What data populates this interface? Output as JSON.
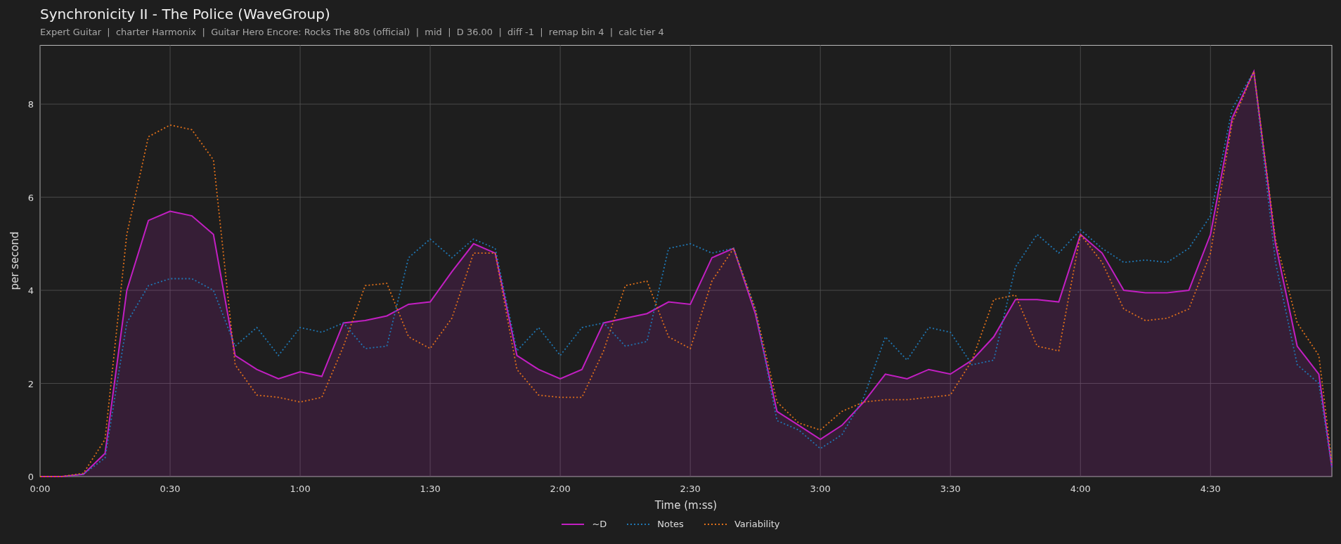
{
  "title": "Synchronicity II - The Police (WaveGroup)",
  "subtitle": "Expert Guitar  |  charter Harmonix  |  Guitar Hero Encore: Rocks The 80s (official)  |  mid  |  D 36.00  |  diff -1  |  remap bin 4  |  calc tier 4",
  "chart_data": {
    "type": "line",
    "xlabel": "Time (m:ss)",
    "ylabel": "per second",
    "x": [
      0,
      5,
      10,
      15,
      20,
      25,
      30,
      35,
      40,
      45,
      50,
      55,
      60,
      65,
      70,
      75,
      80,
      85,
      90,
      95,
      100,
      105,
      110,
      115,
      120,
      125,
      130,
      135,
      140,
      145,
      150,
      155,
      160,
      165,
      170,
      175,
      180,
      185,
      190,
      195,
      200,
      205,
      210,
      215,
      220,
      225,
      230,
      235,
      240,
      245,
      250,
      255,
      260,
      265,
      270,
      275,
      280,
      285,
      290,
      295,
      298
    ],
    "grid": true,
    "xlim": [
      0,
      298
    ],
    "ylim": [
      0,
      9.27
    ],
    "xticks": [
      {
        "value": 0,
        "label": "0:00"
      },
      {
        "value": 30,
        "label": "0:30"
      },
      {
        "value": 60,
        "label": "1:00"
      },
      {
        "value": 90,
        "label": "1:30"
      },
      {
        "value": 120,
        "label": "2:00"
      },
      {
        "value": 150,
        "label": "2:30"
      },
      {
        "value": 180,
        "label": "3:00"
      },
      {
        "value": 210,
        "label": "3:30"
      },
      {
        "value": 240,
        "label": "4:00"
      },
      {
        "value": 270,
        "label": "4:30"
      }
    ],
    "yticks": [
      0,
      2,
      4,
      6,
      8
    ],
    "series": [
      {
        "name": "~D",
        "color": "#c21fc2",
        "line_style": "solid",
        "values": [
          0,
          0,
          0.05,
          0.5,
          4.0,
          5.5,
          5.7,
          5.6,
          5.2,
          2.6,
          2.3,
          2.1,
          2.25,
          2.15,
          3.3,
          3.35,
          3.45,
          3.7,
          3.75,
          4.4,
          5.0,
          4.8,
          2.6,
          2.3,
          2.1,
          2.3,
          3.3,
          3.4,
          3.5,
          3.75,
          3.7,
          4.7,
          4.9,
          3.5,
          1.4,
          1.1,
          0.8,
          1.1,
          1.6,
          2.2,
          2.1,
          2.3,
          2.2,
          2.5,
          3.0,
          3.8,
          3.8,
          3.75,
          5.2,
          4.8,
          4.0,
          3.95,
          3.95,
          4.0,
          5.2,
          7.7,
          8.7,
          5.0,
          2.8,
          2.2,
          0.2
        ]
      },
      {
        "name": "Notes",
        "color": "#1f77b4",
        "line_style": "dotted",
        "values": [
          0,
          0,
          0.05,
          0.4,
          3.3,
          4.1,
          4.25,
          4.25,
          4.0,
          2.8,
          3.2,
          2.6,
          3.2,
          3.1,
          3.3,
          2.75,
          2.8,
          4.7,
          5.1,
          4.7,
          5.1,
          4.9,
          2.7,
          3.2,
          2.6,
          3.2,
          3.3,
          2.8,
          2.9,
          4.9,
          5.0,
          4.8,
          4.9,
          3.6,
          1.2,
          1.0,
          0.6,
          0.9,
          1.7,
          3.0,
          2.5,
          3.2,
          3.1,
          2.4,
          2.5,
          4.5,
          5.2,
          4.8,
          5.3,
          4.9,
          4.6,
          4.65,
          4.6,
          4.9,
          5.6,
          7.9,
          8.7,
          4.6,
          2.4,
          2.0,
          0.2
        ]
      },
      {
        "name": "Variability",
        "color": "#e0701a",
        "line_style": "dotted",
        "values": [
          0,
          0,
          0.07,
          0.8,
          5.2,
          7.3,
          7.55,
          7.45,
          6.8,
          2.4,
          1.75,
          1.7,
          1.6,
          1.7,
          2.8,
          4.1,
          4.15,
          3.0,
          2.75,
          3.4,
          4.8,
          4.8,
          2.3,
          1.75,
          1.7,
          1.7,
          2.7,
          4.1,
          4.2,
          3.0,
          2.75,
          4.2,
          4.9,
          3.6,
          1.6,
          1.15,
          1.0,
          1.4,
          1.6,
          1.65,
          1.65,
          1.7,
          1.75,
          2.5,
          3.8,
          3.9,
          2.8,
          2.7,
          5.2,
          4.6,
          3.6,
          3.35,
          3.4,
          3.6,
          4.8,
          7.6,
          8.7,
          5.1,
          3.3,
          2.6,
          0.3
        ]
      }
    ]
  }
}
